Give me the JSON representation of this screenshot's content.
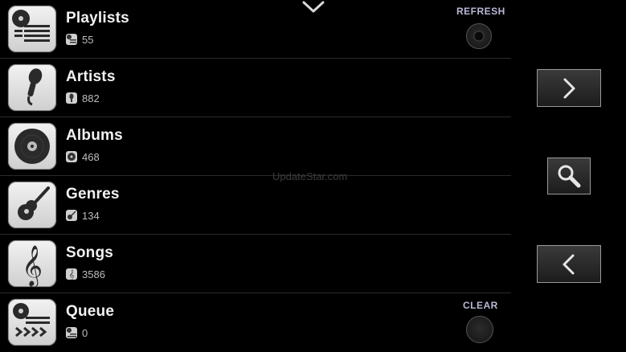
{
  "app": {
    "watermark": "UpdateStar.com",
    "accent_color": "#b9b9d6"
  },
  "header": {
    "collapse_icon": "chevron-down-icon"
  },
  "library": {
    "items": [
      {
        "label": "Playlists",
        "count": "55",
        "icon": "playlist-icon"
      },
      {
        "label": "Artists",
        "count": "882",
        "icon": "microphone-icon"
      },
      {
        "label": "Albums",
        "count": "468",
        "icon": "album-disc-icon"
      },
      {
        "label": "Genres",
        "count": "134",
        "icon": "guitar-icon"
      },
      {
        "label": "Songs",
        "count": "3586",
        "icon": "treble-clef-icon"
      },
      {
        "label": "Queue",
        "count": "0",
        "icon": "queue-icon"
      }
    ],
    "refresh_label": "REFRESH",
    "clear_label": "CLEAR"
  },
  "controls": {
    "next_icon": "chevron-right-icon",
    "search_icon": "search-icon",
    "back_icon": "chevron-left-icon"
  }
}
